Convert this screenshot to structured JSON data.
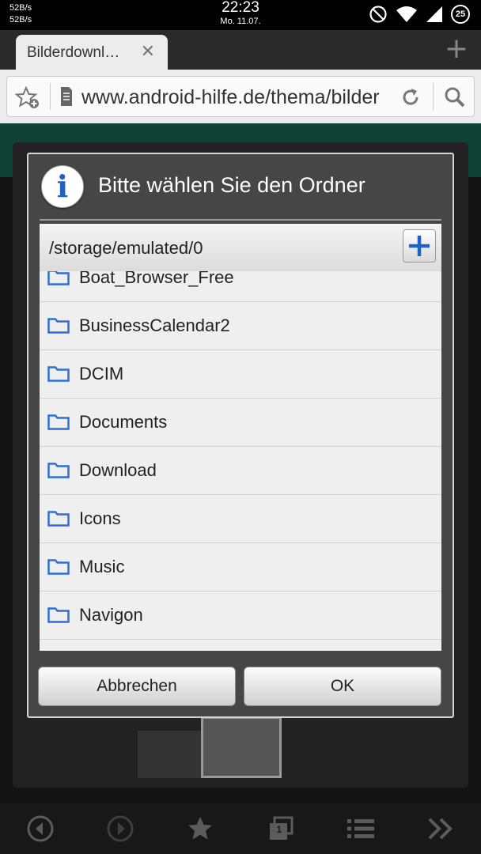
{
  "status_bar": {
    "net_up": "52B/s",
    "net_down": "52B/s",
    "time": "22:23",
    "date": "Mo. 11.07.",
    "battery": "25"
  },
  "browser": {
    "tab_title": "Bilderdownl…",
    "tab_close": "✕",
    "new_tab": "+",
    "url": "www.android-hilfe.de/thema/bilder"
  },
  "dialog": {
    "title": "Bitte wählen Sie den Ordner",
    "info_glyph": "i",
    "path": "/storage/emulated/0",
    "folders": [
      {
        "label": "Boat_Browser_Free"
      },
      {
        "label": "BusinessCalendar2"
      },
      {
        "label": "DCIM"
      },
      {
        "label": "Documents"
      },
      {
        "label": "Download"
      },
      {
        "label": "Icons"
      },
      {
        "label": "Music"
      },
      {
        "label": "Navigon"
      }
    ],
    "cancel_label": "Abbrechen",
    "ok_label": "OK"
  },
  "bottom_nav": {
    "tabs_count": "1"
  },
  "colors": {
    "accent": "#1e62c6",
    "dialog_bg": "#464646",
    "list_bg": "#efefef"
  }
}
